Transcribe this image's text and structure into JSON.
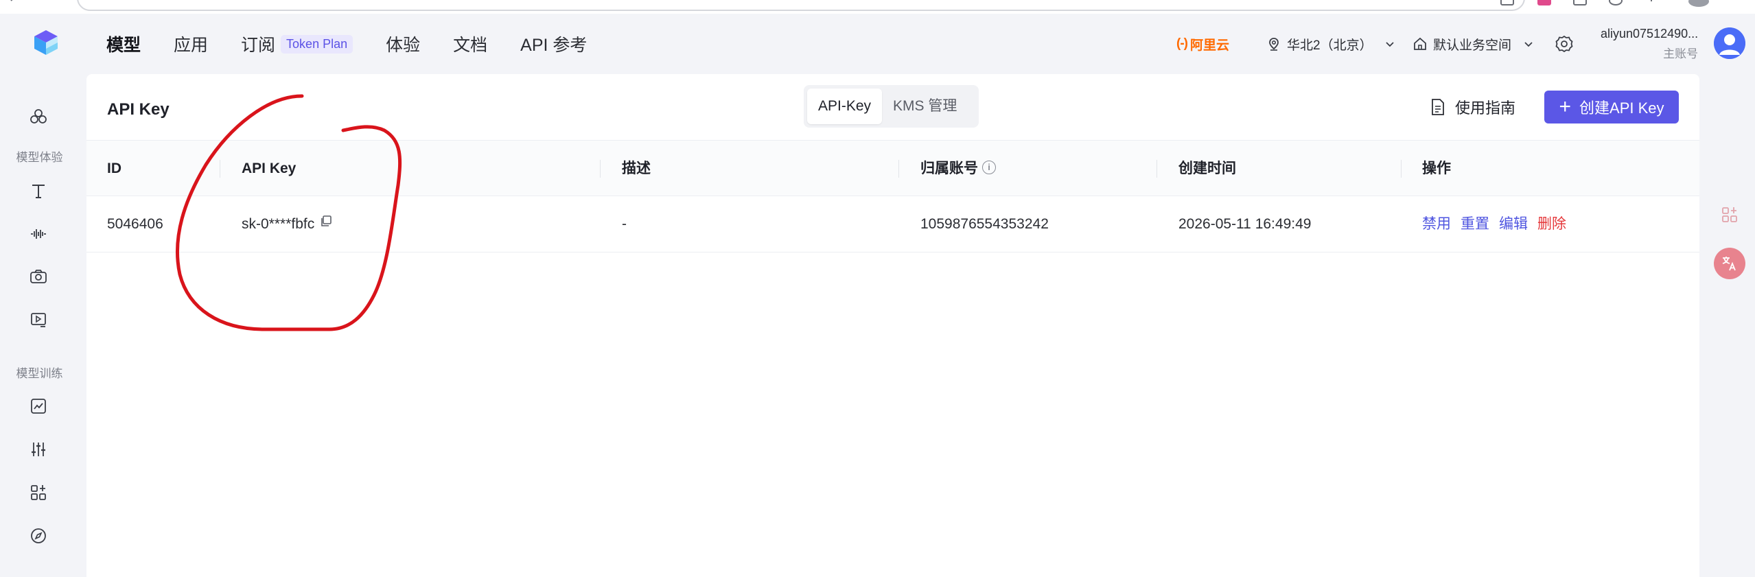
{
  "header": {
    "nav": [
      {
        "label": "模型",
        "active": true
      },
      {
        "label": "应用",
        "active": false
      },
      {
        "label": "订阅",
        "badge": "Token Plan",
        "active": false
      },
      {
        "label": "体验",
        "active": false
      },
      {
        "label": "文档",
        "active": false
      },
      {
        "label": "API 参考",
        "active": false
      }
    ],
    "brand": "阿里云",
    "region": "华北2（北京）",
    "workspace": "默认业务空间",
    "account_name": "aliyun07512490...",
    "account_role": "主账号"
  },
  "sidebar": {
    "section_experience": "模型体验",
    "section_training": "模型训练",
    "icons": [
      "models-icon",
      "text-icon",
      "audio-wave-icon",
      "camera-icon",
      "video-icon",
      "chart-icon",
      "sliders-icon",
      "apps-icon",
      "compass-icon"
    ]
  },
  "page": {
    "title": "API Key",
    "tabs": [
      {
        "label": "API-Key",
        "active": true
      },
      {
        "label": "KMS 管理",
        "active": false
      }
    ],
    "guide_label": "使用指南",
    "create_label": "创建API Key"
  },
  "table": {
    "columns": [
      "ID",
      "API Key",
      "描述",
      "归属账号",
      "创建时间",
      "操作"
    ],
    "rows": [
      {
        "id": "5046406",
        "api_key": "sk-0****fbfc",
        "description": "-",
        "account": "1059876554353242",
        "created": "2026-05-11 16:49:49",
        "actions": [
          "禁用",
          "重置",
          "编辑",
          "删除"
        ]
      }
    ]
  },
  "colors": {
    "accent": "#5b57e6",
    "link": "#4f55e0",
    "danger": "#e5383b",
    "brand_orange": "#ff6a00",
    "annotation_red": "#d9141b"
  }
}
